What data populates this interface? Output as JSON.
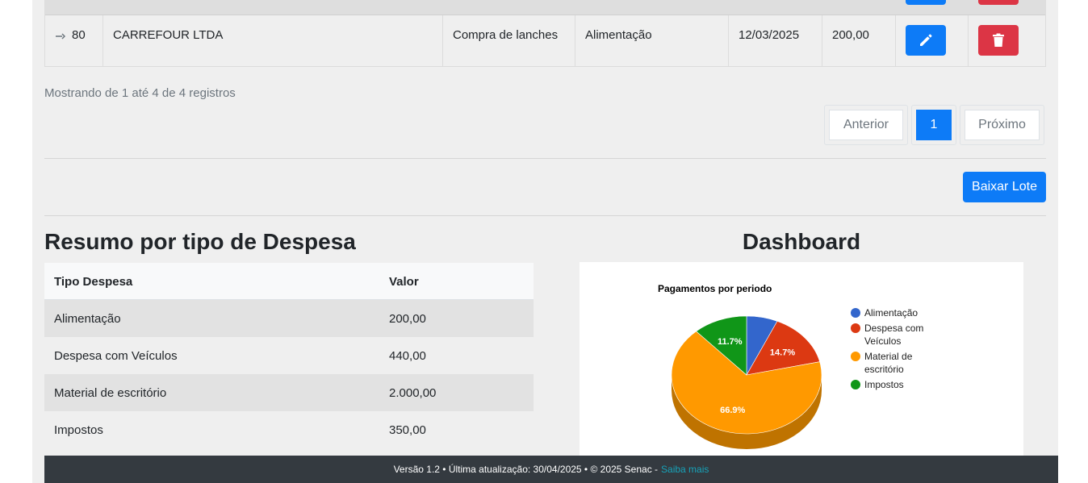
{
  "table_row": {
    "id": "80",
    "fornecedor": "CARREFOUR LTDA",
    "descricao": "Compra de lanches",
    "tipo": "Alimentação",
    "data": "12/03/2025",
    "valor": "200,00"
  },
  "pagination": {
    "info": "Mostrando de 1 até 4 de 4 registros",
    "previous": "Anterior",
    "current": "1",
    "next": "Próximo"
  },
  "actions": {
    "baixar_lote": "Baixar Lote"
  },
  "summary": {
    "title": "Resumo por tipo de Despesa",
    "headers": {
      "tipo": "Tipo Despesa",
      "valor": "Valor"
    },
    "rows": [
      {
        "tipo": "Alimentação",
        "valor": "200,00"
      },
      {
        "tipo": "Despesa com Veículos",
        "valor": "440,00"
      },
      {
        "tipo": "Material de escritório",
        "valor": "2.000,00"
      },
      {
        "tipo": "Impostos",
        "valor": "350,00"
      }
    ]
  },
  "dashboard": {
    "title": "Dashboard"
  },
  "chart_data": {
    "type": "pie",
    "title": "Pagamentos por periodo",
    "legend_position": "right",
    "categories": [
      "Alimentação",
      "Despesa com Veículos",
      "Material de escritório",
      "Impostos"
    ],
    "legend_lines": [
      [
        "Alimentação"
      ],
      [
        "Despesa com",
        "Veículos"
      ],
      [
        "Material de",
        "escritório"
      ],
      [
        "Impostos"
      ]
    ],
    "values": [
      200,
      440,
      2000,
      350
    ],
    "labels": [
      "",
      "14.7%",
      "66.9%",
      "11.7%"
    ],
    "colors": [
      "#3366cc",
      "#dc3912",
      "#ff9900",
      "#109618"
    ],
    "side_colors": [
      "#264d99",
      "#a52b0e",
      "#bf7300",
      "#0c7112"
    ]
  },
  "footer": {
    "text": "Versão 1.2 • Última atualização: 30/04/2025 • © 2025 Senac -",
    "link": "Saiba mais"
  }
}
